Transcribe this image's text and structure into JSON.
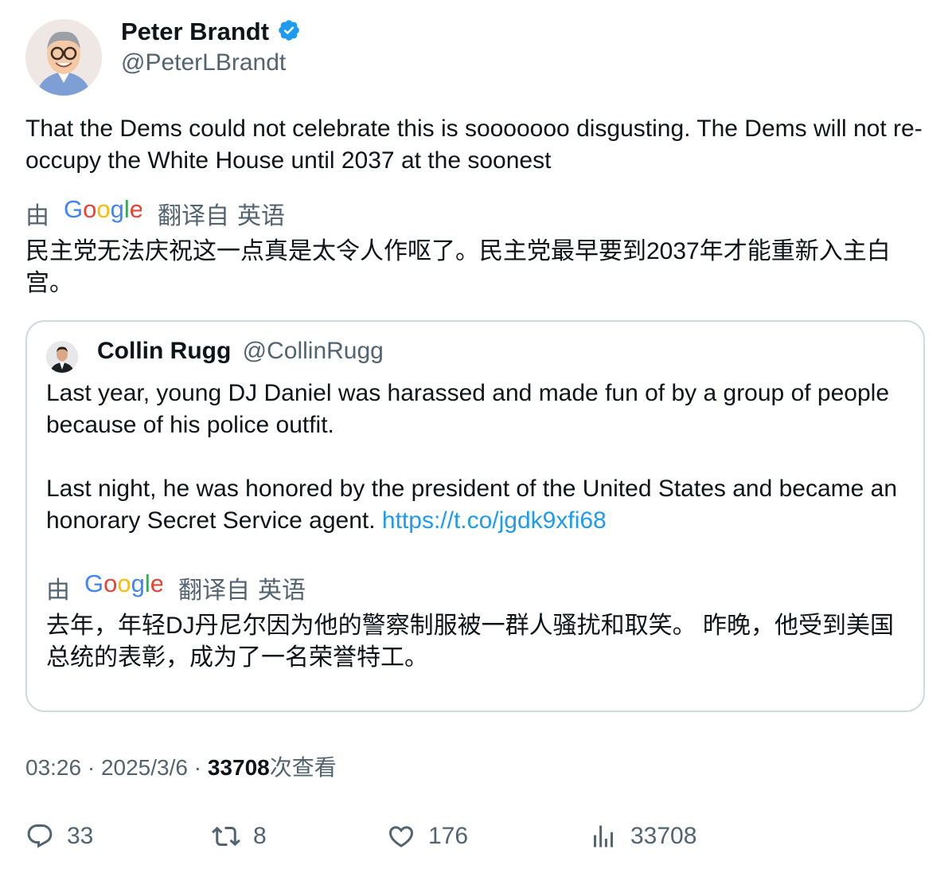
{
  "author": {
    "name": "Peter Brandt",
    "handle": "@PeterLBrandt",
    "verified": true,
    "verified_color": "#1d9bf0"
  },
  "tweet": {
    "text": "That the Dems could not celebrate this is sooooooo disgusting. The Dems will not re-occupy the White House until 2037 at the soonest",
    "translation": {
      "by_label": "由",
      "provider": "Google",
      "from_label": "翻译自",
      "language": "英语",
      "text": "民主党无法庆祝这一点真是太令人作呕了。民主党最早要到2037年才能重新入主白宫。"
    }
  },
  "quote": {
    "name": "Collin Rugg",
    "handle": "@CollinRugg",
    "text_p1": "Last year, young DJ Daniel was harassed and made fun of by a group of people because of his police outfit.",
    "text_p2": "Last night, he was honored by the president of the United States and became an honorary Secret Service agent.",
    "link": "https://t.co/jgdk9xfi68",
    "translation": {
      "by_label": "由",
      "provider": "Google",
      "from_label": "翻译自",
      "language": "英语",
      "text": "去年，年轻DJ丹尼尔因为他的警察制服被一群人骚扰和取笑。 昨晚，他受到美国总统的表彰，成为了一名荣誉特工。"
    }
  },
  "meta": {
    "time": "03:26",
    "separator": " · ",
    "date": "2025/3/6",
    "views_count": "33708",
    "views_label": "次查看"
  },
  "actions": {
    "replies": "33",
    "retweets": "8",
    "likes": "176",
    "views": "33708"
  },
  "colors": {
    "text": "#0f1419",
    "secondary": "#536471",
    "link": "#1d9bf0",
    "border": "#cfd9de"
  },
  "icons": [
    "verified-badge-icon",
    "reply-icon",
    "retweet-icon",
    "like-icon",
    "views-icon",
    "google-logo"
  ]
}
